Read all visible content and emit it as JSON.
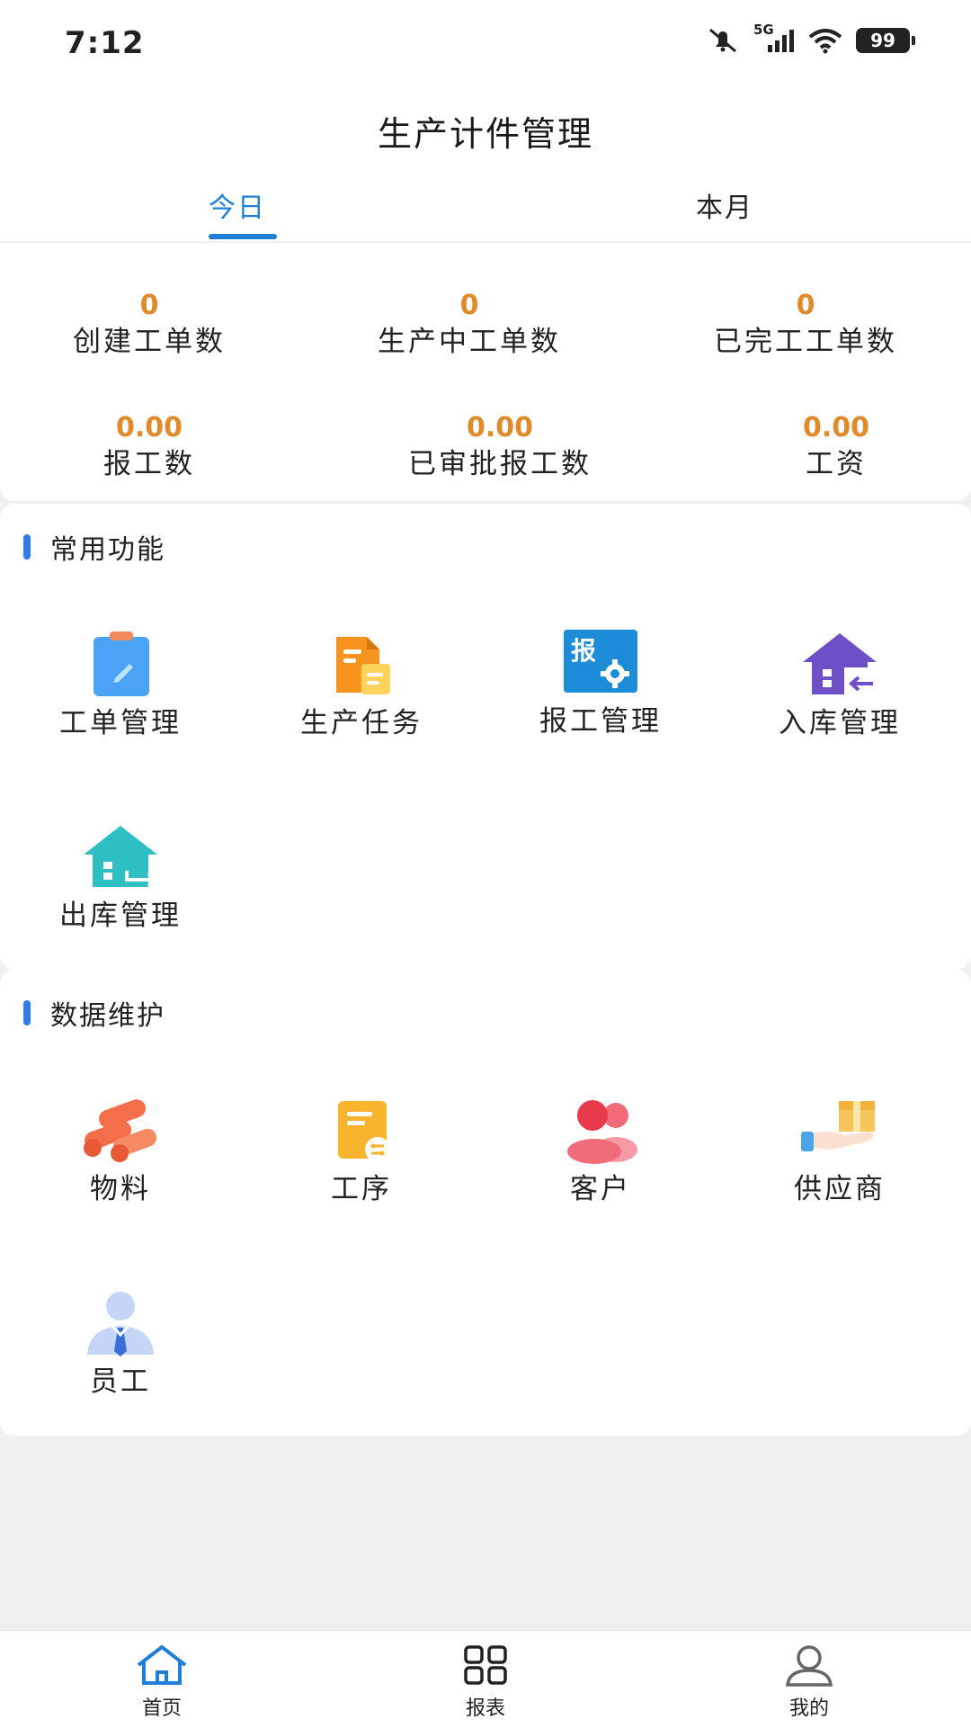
{
  "status_bar": {
    "time": "7:12",
    "network": "5G",
    "battery": "99"
  },
  "header": {
    "title": "生产计件管理"
  },
  "tabs": [
    {
      "label": "今日",
      "active": true
    },
    {
      "label": "本月",
      "active": false
    }
  ],
  "stats": [
    {
      "value": "0",
      "label": "创建工单数"
    },
    {
      "value": "0",
      "label": "生产中工单数"
    },
    {
      "value": "0",
      "label": "已完工工单数"
    },
    {
      "value": "0.00",
      "label": "报工数"
    },
    {
      "value": "0.00",
      "label": "已审批报工数"
    },
    {
      "value": "0.00",
      "label": "工资"
    }
  ],
  "common_functions": {
    "title": "常用功能",
    "items": [
      {
        "label": "工单管理",
        "icon": "work-order-icon"
      },
      {
        "label": "生产任务",
        "icon": "production-task-icon"
      },
      {
        "label": "报工管理",
        "icon": "report-work-icon",
        "icon_text": "报"
      },
      {
        "label": "入库管理",
        "icon": "inbound-icon"
      },
      {
        "label": "出库管理",
        "icon": "outbound-icon"
      }
    ]
  },
  "data_maintenance": {
    "title": "数据维护",
    "items": [
      {
        "label": "物料",
        "icon": "material-icon"
      },
      {
        "label": "工序",
        "icon": "process-icon"
      },
      {
        "label": "客户",
        "icon": "customer-icon"
      },
      {
        "label": "供应商",
        "icon": "supplier-icon"
      },
      {
        "label": "员工",
        "icon": "employee-icon"
      }
    ]
  },
  "bottom_nav": [
    {
      "label": "首页",
      "icon": "home-icon"
    },
    {
      "label": "报表",
      "icon": "grid-icon"
    },
    {
      "label": "我的",
      "icon": "user-icon"
    }
  ],
  "colors": {
    "accent": "#1f7fd6",
    "stat_value": "#e08a2a",
    "section_bar": "#2f7ce8"
  }
}
